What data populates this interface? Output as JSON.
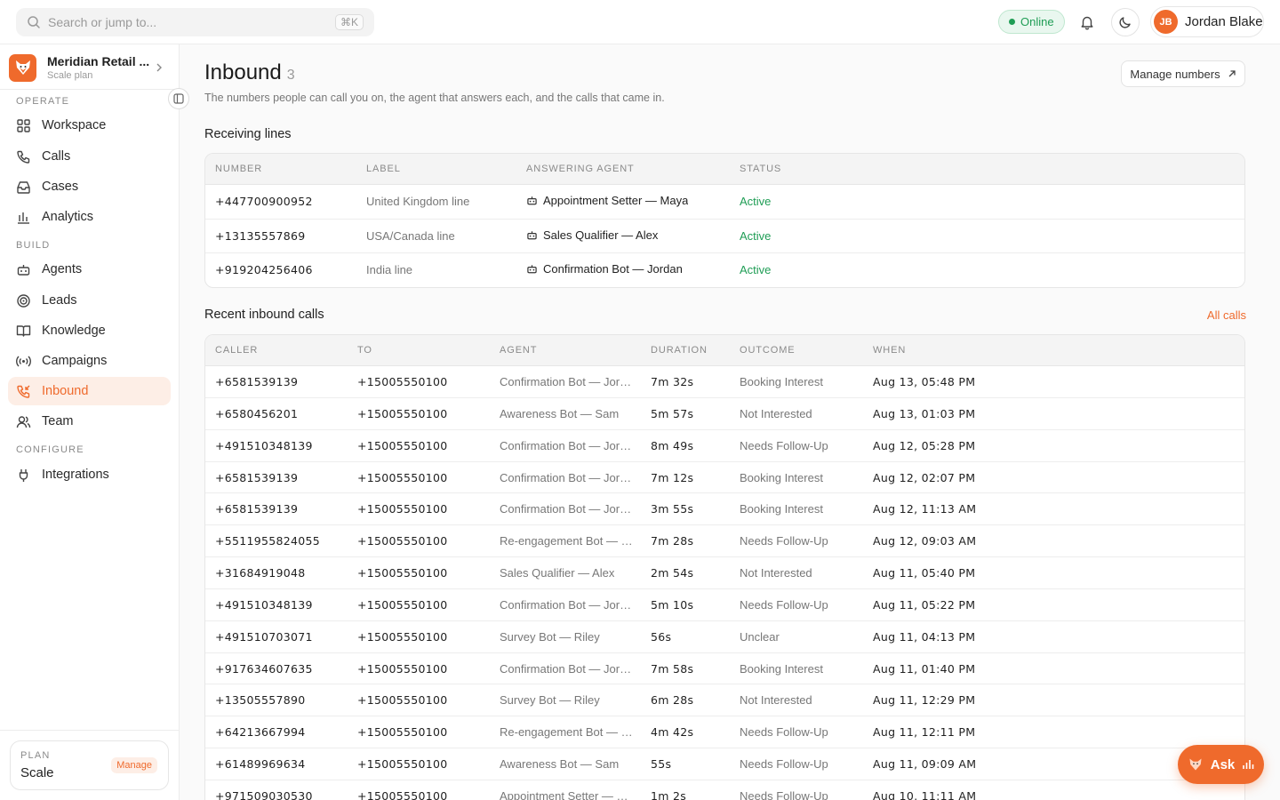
{
  "search": {
    "placeholder": "Search or jump to...",
    "shortcut": "⌘K"
  },
  "header": {
    "status": "Online",
    "user_initials": "JB",
    "user_name": "Jordan Blake"
  },
  "org": {
    "name": "Meridian Retail ...",
    "plan": "Scale plan"
  },
  "sidebar": {
    "sections": {
      "operate": "OPERATE",
      "build": "BUILD",
      "configure": "CONFIGURE"
    },
    "items": [
      {
        "label": "Workspace",
        "icon": "grid-icon"
      },
      {
        "label": "Calls",
        "icon": "phone-icon"
      },
      {
        "label": "Cases",
        "icon": "inbox-icon"
      },
      {
        "label": "Analytics",
        "icon": "bar-chart-icon"
      },
      {
        "label": "Agents",
        "icon": "robot-icon"
      },
      {
        "label": "Leads",
        "icon": "target-icon"
      },
      {
        "label": "Knowledge",
        "icon": "book-icon"
      },
      {
        "label": "Campaigns",
        "icon": "broadcast-icon"
      },
      {
        "label": "Inbound",
        "icon": "phone-incoming-icon",
        "active": true
      },
      {
        "label": "Team",
        "icon": "users-icon"
      },
      {
        "label": "Integrations",
        "icon": "plug-icon"
      }
    ],
    "plan": {
      "label": "PLAN",
      "value": "Scale",
      "action": "Manage"
    }
  },
  "page": {
    "title": "Inbound",
    "count": "3",
    "subtitle": "The numbers people can call you on, the agent that answers each, and the calls that came in.",
    "manage_button": "Manage numbers"
  },
  "lines": {
    "heading": "Receiving lines",
    "columns": [
      "NUMBER",
      "LABEL",
      "ANSWERING AGENT",
      "STATUS"
    ],
    "rows": [
      {
        "number": "+447700900952",
        "label": "United Kingdom line",
        "agent": "Appointment Setter — Maya",
        "status": "Active"
      },
      {
        "number": "+13135557869",
        "label": "USA/Canada line",
        "agent": "Sales Qualifier — Alex",
        "status": "Active"
      },
      {
        "number": "+919204256406",
        "label": "India line",
        "agent": "Confirmation Bot — Jordan",
        "status": "Active"
      }
    ]
  },
  "calls": {
    "heading": "Recent inbound calls",
    "all_link": "All calls",
    "columns": [
      "CALLER",
      "TO",
      "AGENT",
      "DURATION",
      "OUTCOME",
      "WHEN"
    ],
    "rows": [
      {
        "caller": "+6581539139",
        "to": "+15005550100",
        "agent": "Confirmation Bot — Jordan",
        "duration": "7m 32s",
        "outcome": "Booking Interest",
        "when": "Aug 13, 05:48 PM"
      },
      {
        "caller": "+6580456201",
        "to": "+15005550100",
        "agent": "Awareness Bot — Sam",
        "duration": "5m 57s",
        "outcome": "Not Interested",
        "when": "Aug 13, 01:03 PM"
      },
      {
        "caller": "+491510348139",
        "to": "+15005550100",
        "agent": "Confirmation Bot — Jordan",
        "duration": "8m 49s",
        "outcome": "Needs Follow-Up",
        "when": "Aug 12, 05:28 PM"
      },
      {
        "caller": "+6581539139",
        "to": "+15005550100",
        "agent": "Confirmation Bot — Jordan",
        "duration": "7m 12s",
        "outcome": "Booking Interest",
        "when": "Aug 12, 02:07 PM"
      },
      {
        "caller": "+6581539139",
        "to": "+15005550100",
        "agent": "Confirmation Bot — Jordan",
        "duration": "3m 55s",
        "outcome": "Booking Interest",
        "when": "Aug 12, 11:13 AM"
      },
      {
        "caller": "+5511955824055",
        "to": "+15005550100",
        "agent": "Re-engagement Bot — C...",
        "duration": "7m 28s",
        "outcome": "Needs Follow-Up",
        "when": "Aug 12, 09:03 AM"
      },
      {
        "caller": "+31684919048",
        "to": "+15005550100",
        "agent": "Sales Qualifier — Alex",
        "duration": "2m 54s",
        "outcome": "Not Interested",
        "when": "Aug 11, 05:40 PM"
      },
      {
        "caller": "+491510348139",
        "to": "+15005550100",
        "agent": "Confirmation Bot — Jordan",
        "duration": "5m 10s",
        "outcome": "Needs Follow-Up",
        "when": "Aug 11, 05:22 PM"
      },
      {
        "caller": "+491510703071",
        "to": "+15005550100",
        "agent": "Survey Bot — Riley",
        "duration": "56s",
        "outcome": "Unclear",
        "when": "Aug 11, 04:13 PM"
      },
      {
        "caller": "+917634607635",
        "to": "+15005550100",
        "agent": "Confirmation Bot — Jordan",
        "duration": "7m 58s",
        "outcome": "Booking Interest",
        "when": "Aug 11, 01:40 PM"
      },
      {
        "caller": "+13505557890",
        "to": "+15005550100",
        "agent": "Survey Bot — Riley",
        "duration": "6m 28s",
        "outcome": "Not Interested",
        "when": "Aug 11, 12:29 PM"
      },
      {
        "caller": "+64213667994",
        "to": "+15005550100",
        "agent": "Re-engagement Bot — C...",
        "duration": "4m 42s",
        "outcome": "Needs Follow-Up",
        "when": "Aug 11, 12:11 PM"
      },
      {
        "caller": "+61489969634",
        "to": "+15005550100",
        "agent": "Awareness Bot — Sam",
        "duration": "55s",
        "outcome": "Needs Follow-Up",
        "when": "Aug 11, 09:09 AM"
      },
      {
        "caller": "+971509030530",
        "to": "+15005550100",
        "agent": "Appointment Setter — Ma...",
        "duration": "1m 2s",
        "outcome": "Needs Follow-Up",
        "when": "Aug 10, 11:11 AM"
      }
    ]
  },
  "ask": {
    "label": "Ask"
  },
  "colors": {
    "accent": "#ef6a2c",
    "success": "#1f9d55"
  }
}
